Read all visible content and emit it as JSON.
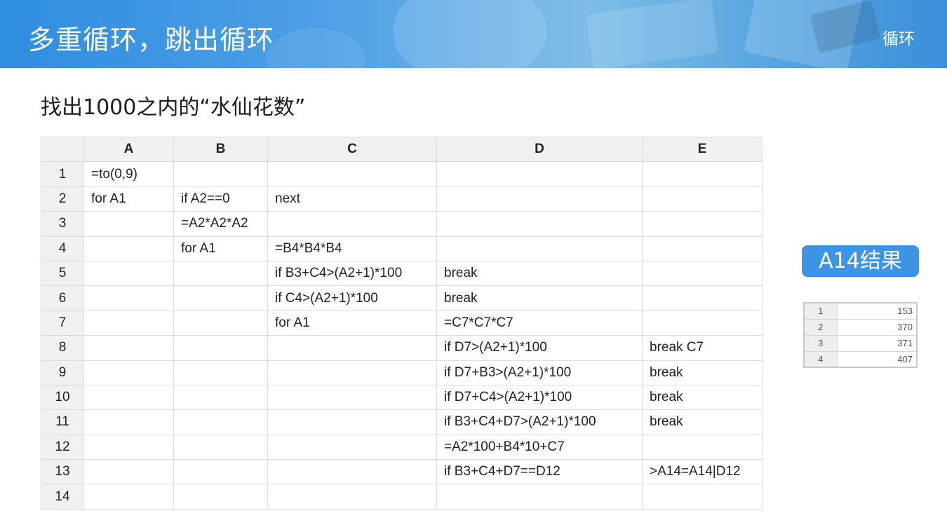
{
  "header": {
    "title": "多重循环，跳出循环",
    "topic": "循环"
  },
  "subtitle": "找出1000之内的“水仙花数”",
  "sheet": {
    "columns": [
      "A",
      "B",
      "C",
      "D",
      "E"
    ],
    "rows": [
      {
        "num": "1",
        "cells": [
          "=to(0,9)",
          "",
          "",
          "",
          ""
        ]
      },
      {
        "num": "2",
        "cells": [
          "for A1",
          "if A2==0",
          "next",
          "",
          ""
        ]
      },
      {
        "num": "3",
        "cells": [
          "",
          "=A2*A2*A2",
          "",
          "",
          ""
        ]
      },
      {
        "num": "4",
        "cells": [
          "",
          "for A1",
          "=B4*B4*B4",
          "",
          ""
        ]
      },
      {
        "num": "5",
        "cells": [
          "",
          "",
          "if B3+C4>(A2+1)*100",
          "break",
          ""
        ]
      },
      {
        "num": "6",
        "cells": [
          "",
          "",
          "if C4>(A2+1)*100",
          "break",
          ""
        ]
      },
      {
        "num": "7",
        "cells": [
          "",
          "",
          "for A1",
          "=C7*C7*C7",
          ""
        ]
      },
      {
        "num": "8",
        "cells": [
          "",
          "",
          "",
          "if D7>(A2+1)*100",
          "break C7"
        ]
      },
      {
        "num": "9",
        "cells": [
          "",
          "",
          "",
          "if D7+B3>(A2+1)*100",
          "break"
        ]
      },
      {
        "num": "10",
        "cells": [
          "",
          "",
          "",
          "if D7+C4>(A2+1)*100",
          "break"
        ]
      },
      {
        "num": "11",
        "cells": [
          "",
          "",
          "",
          "if B3+C4+D7>(A2+1)*100",
          "break"
        ]
      },
      {
        "num": "12",
        "cells": [
          "",
          "",
          "",
          "=A2*100+B4*10+C7",
          ""
        ]
      },
      {
        "num": "13",
        "cells": [
          "",
          "",
          "",
          "if B3+C4+D7==D12",
          ">A14=A14|D12"
        ]
      },
      {
        "num": "14",
        "cells": [
          "",
          "",
          "",
          "",
          ""
        ]
      }
    ]
  },
  "result": {
    "label": "A14结果",
    "rows": [
      {
        "index": "1",
        "value": "153"
      },
      {
        "index": "2",
        "value": "370"
      },
      {
        "index": "3",
        "value": "371"
      },
      {
        "index": "4",
        "value": "407"
      }
    ]
  }
}
